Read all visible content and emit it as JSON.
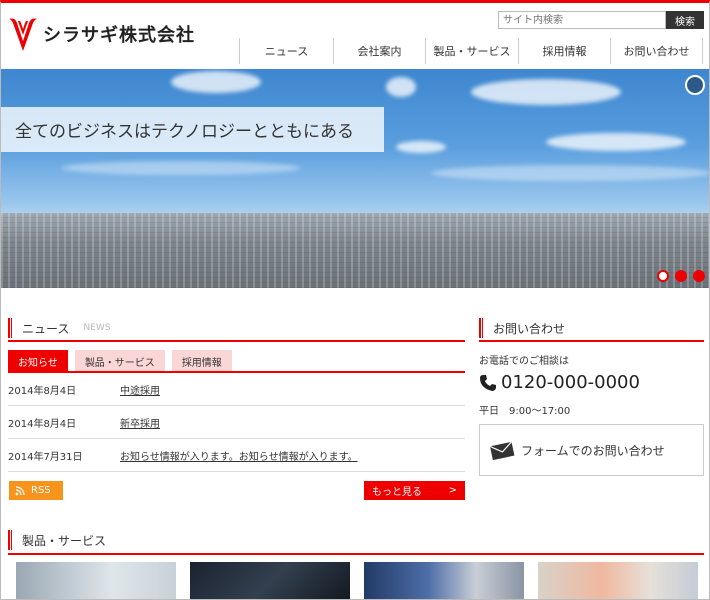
{
  "brand": {
    "name": "シラサギ株式会社",
    "accent": "#e00000"
  },
  "search": {
    "placeholder": "サイト内検索",
    "button": "検索"
  },
  "nav": [
    {
      "label": "ニュース"
    },
    {
      "label": "会社案内"
    },
    {
      "label": "製品・サービス"
    },
    {
      "label": "採用情報"
    },
    {
      "label": "お問い合わせ"
    }
  ],
  "hero": {
    "tagline": "全てのビジネスはテクノロジーとともにある",
    "slide_count": 3,
    "active_slide": 1
  },
  "news": {
    "title": "ニュース",
    "subtitle": "NEWS",
    "tabs": [
      "お知らせ",
      "製品・サービス",
      "採用情報"
    ],
    "items": [
      {
        "date": "2014年8月4日",
        "title": "中途採用"
      },
      {
        "date": "2014年8月4日",
        "title": "新卒採用"
      },
      {
        "date": "2014年7月31日",
        "title": "お知らせ情報が入ります。お知らせ情報が入ります。"
      }
    ],
    "rss_label": "RSS",
    "more_label": "もっと見る",
    "more_arrow": ">"
  },
  "contact": {
    "title": "お問い合わせ",
    "lead": "お電話でのご相談は",
    "phone": "0120-000-0000",
    "hours": "平日　9:00〜17:00",
    "form_label": "フォームでのお問い合わせ"
  },
  "products": {
    "title": "製品・サービス"
  },
  "icons": [
    "shirasagi-logo",
    "pause-icon",
    "rss-icon",
    "phone-icon",
    "mail-icon"
  ]
}
